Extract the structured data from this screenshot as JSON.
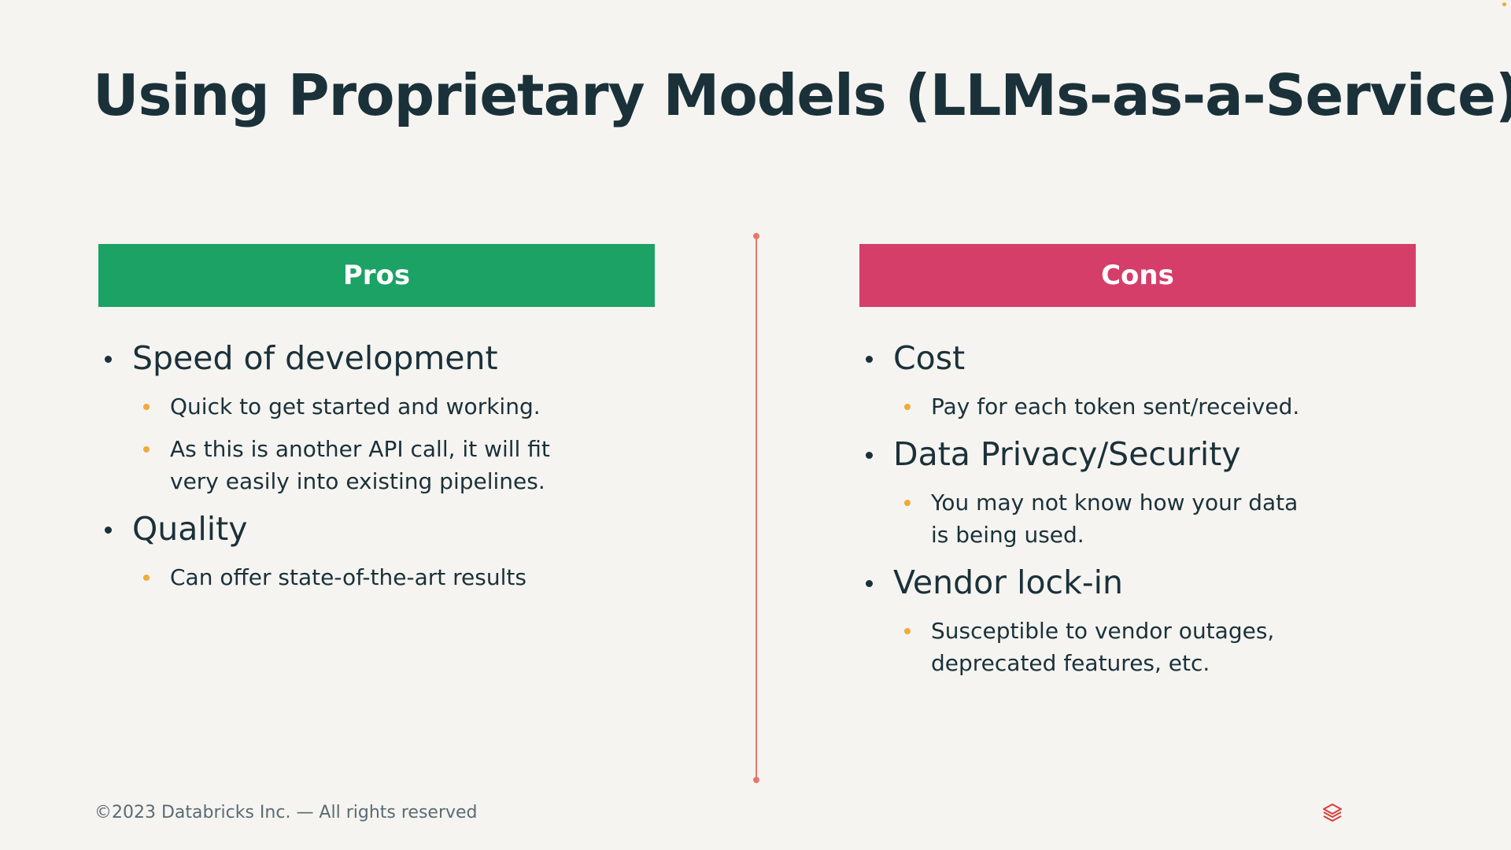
{
  "slide": {
    "title": "Using Proprietary Models (LLMs-as-a-Service)"
  },
  "colors": {
    "pros_header": "#1BA264",
    "cons_header": "#D63E6A",
    "sub_bullet": "#F2A93B",
    "divider": "#E8766A",
    "text": "#1B3139",
    "background": "#F5F4F1"
  },
  "pros": {
    "header": "Pros",
    "items": [
      {
        "label": "Speed of development",
        "subs": [
          "Quick to get started and working.",
          "As this is another API call, it will fit very easily into existing pipelines."
        ]
      },
      {
        "label": "Quality",
        "subs": [
          "Can offer state-of-the-art results"
        ]
      }
    ]
  },
  "cons": {
    "header": "Cons",
    "items": [
      {
        "label": "Cost",
        "subs": [
          "Pay for each token sent/received."
        ]
      },
      {
        "label": "Data Privacy/Security",
        "subs": [
          "You may not know how your data is being used."
        ]
      },
      {
        "label": "Vendor lock-in",
        "subs": [
          "Susceptible to vendor outages, deprecated features, etc."
        ]
      }
    ]
  },
  "footer": {
    "copyright": "©2023 Databricks Inc. — All rights reserved",
    "logo_icon": "databricks-logo-icon"
  }
}
